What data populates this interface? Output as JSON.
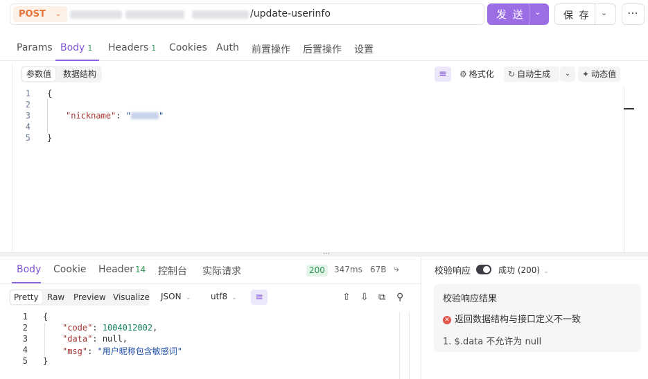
{
  "url_bar": {
    "method": "POST",
    "url_suffix": "/update-userinfo",
    "send_label": "发 送",
    "save_label": "保 存"
  },
  "request_tabs": [
    {
      "label": "Params"
    },
    {
      "label": "Body",
      "badge": "1"
    },
    {
      "label": "Headers",
      "badge": "1"
    },
    {
      "label": "Cookies"
    },
    {
      "label": "Auth"
    },
    {
      "label": "前置操作"
    },
    {
      "label": "后置操作"
    },
    {
      "label": "设置"
    }
  ],
  "body_toolbar": {
    "segments": [
      "参数值",
      "数据结构"
    ],
    "format_label": "格式化",
    "auto_gen_label": "自动生成",
    "dynamic_label": "动态值"
  },
  "request_body": {
    "line_numbers": [
      "1",
      "2",
      "3",
      "4",
      "5"
    ],
    "open_brace": "{",
    "key": "\"nickname\"",
    "colon": ": ",
    "value_quote_open": "\"",
    "value_quote_close": "\"",
    "close_brace": "}"
  },
  "response_tabs": [
    {
      "label": "Body"
    },
    {
      "label": "Cookie"
    },
    {
      "label": "Header",
      "badge": "14"
    },
    {
      "label": "控制台"
    },
    {
      "label": "实际请求"
    }
  ],
  "response_meta": {
    "status": "200",
    "time": "347ms",
    "size": "67B"
  },
  "response_toolbar": {
    "views": [
      "Pretty",
      "Raw",
      "Preview",
      "Visualize"
    ],
    "format": "JSON",
    "encoding": "utf8"
  },
  "response_body": {
    "line_numbers": [
      "1",
      "2",
      "3",
      "4",
      "5"
    ],
    "open_brace": "{",
    "code_key": "\"code\"",
    "code_value": "1004012002",
    "data_key": "\"data\"",
    "data_value": "null",
    "msg_key": "\"msg\"",
    "msg_value": "\"用户昵称包含敏感词\"",
    "close_brace": "}"
  },
  "validation": {
    "header": "校验响应",
    "status": "成功 (200)",
    "card_title": "校验响应结果",
    "error": "返回数据结构与接口定义不一致",
    "detail": "1. $.data 不允许为 null"
  },
  "colors": {
    "accent": "#8a63e0",
    "method": "#e8743a",
    "success": "#31a05a",
    "error": "#e2534a"
  }
}
